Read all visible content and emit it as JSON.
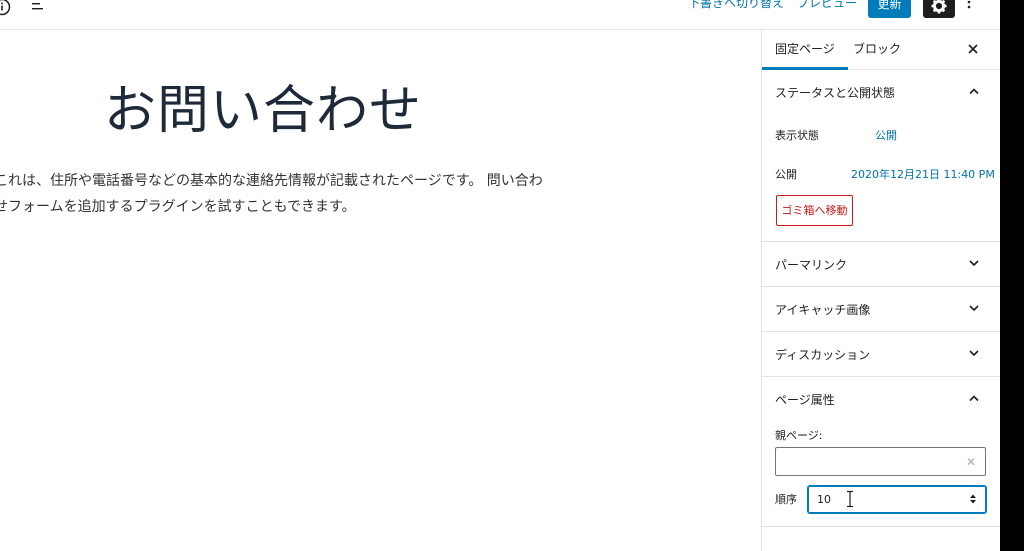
{
  "toolbar": {
    "switch_to_draft": "下書きへ切り替え",
    "preview": "プレビュー",
    "update": "更新"
  },
  "editor": {
    "title": "お問い合わせ",
    "body_line1": "これは、住所や電話番号などの基本的な連絡先情報が記載されたページです。 問い合わ",
    "body_line2": "せフォームを追加するプラグインを試すこともできます。"
  },
  "sidebar": {
    "tabs": [
      "固定ページ",
      "ブロック"
    ],
    "status_panel": {
      "title": "ステータスと公開状態",
      "visibility_label": "表示状態",
      "visibility_value": "公開",
      "publish_label": "公開",
      "publish_value": "2020年12月21日 11:40 PM",
      "trash_button": "ゴミ箱へ移動"
    },
    "panels": [
      "パーマリンク",
      "アイキャッチ画像",
      "ディスカッション"
    ],
    "page_attributes": {
      "title": "ページ属性",
      "parent_label": "親ページ:",
      "parent_value": "",
      "order_label": "順序",
      "order_value": "10"
    }
  },
  "colors": {
    "accent": "#007cba",
    "link": "#0073aa",
    "danger": "#cc1818",
    "dark": "#1e1e1e"
  },
  "icons": [
    "info-icon",
    "list-view-icon",
    "gear-icon",
    "more-vertical-icon",
    "close-icon",
    "chevron-up-icon",
    "chevron-down-icon",
    "clear-icon",
    "spinner-arrows-icon",
    "text-cursor-icon"
  ]
}
